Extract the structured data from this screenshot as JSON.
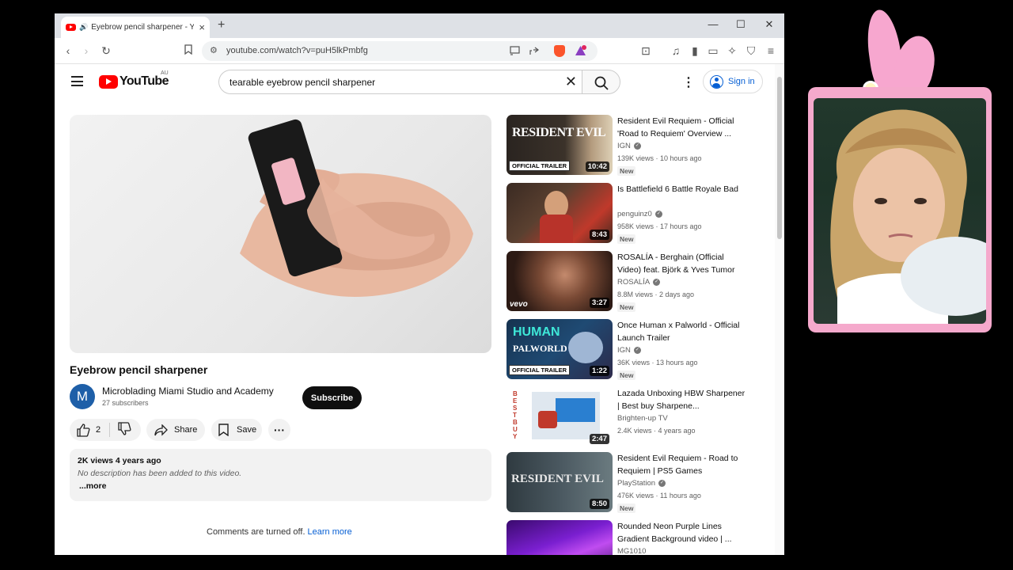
{
  "browser": {
    "tab_title": "Eyebrow pencil sharpener - Y",
    "url": "youtube.com/watch?v=puH5lkPmbfg"
  },
  "youtube": {
    "logo_text": "YouTube",
    "region": "AU",
    "search_query": "tearable eyebrow pencil sharpener",
    "sign_in": "Sign in"
  },
  "video": {
    "title": "Eyebrow pencil sharpener",
    "channel_initial": "M",
    "channel_name": "Microblading Miami Studio and Academy",
    "subscribers": "27 subscribers",
    "subscribe_label": "Subscribe",
    "like_count": "2",
    "share_label": "Share",
    "save_label": "Save",
    "views_age": "2K views  4 years ago",
    "description": "No description has been added to this video.",
    "more_label": "...more",
    "comments_text": "Comments are turned off.",
    "learn_more": "Learn more"
  },
  "recommendations": [
    {
      "title": "Resident Evil Requiem - Official 'Road to Requiem' Overview ...",
      "channel": "IGN",
      "verified": true,
      "views": "139K views · 10 hours ago",
      "badge": "New",
      "duration": "10:42",
      "thumb_label": "OFFICIAL TRAILER",
      "thumb_text": "RESIDENT EVIL"
    },
    {
      "title": "Is Battlefield 6 Battle Royale Bad",
      "channel": "penguinz0",
      "verified": true,
      "views": "958K views · 17 hours ago",
      "badge": "New",
      "duration": "8:43"
    },
    {
      "title": "ROSALÍA - Berghain (Official Video) feat. Björk & Yves Tumor",
      "channel": "ROSALÍA",
      "verified": true,
      "views": "8.8M views · 2 days ago",
      "badge": "New",
      "duration": "3:27",
      "thumb_text": "vevo"
    },
    {
      "title": "Once Human x Palworld - Official Launch Trailer",
      "channel": "IGN",
      "verified": true,
      "views": "36K views · 13 hours ago",
      "badge": "New",
      "duration": "1:22",
      "thumb_label": "OFFICIAL TRAILER",
      "thumb_text": "HUMAN",
      "thumb_text2": "PALWORLD"
    },
    {
      "title": "Lazada Unboxing HBW Sharpener | Best buy Sharpene...",
      "channel": "Brighten-up TV",
      "verified": false,
      "views": "2.4K views · 4 years ago",
      "badge": "",
      "duration": "2:47",
      "thumb_text": "BESTBUY"
    },
    {
      "title": "Resident Evil Requiem - Road to Requiem | PS5 Games",
      "channel": "PlayStation",
      "verified": true,
      "views": "476K views · 11 hours ago",
      "badge": "New",
      "duration": "8:50",
      "thumb_text": "RESIDENT EVIL"
    },
    {
      "title": "Rounded Neon Purple Lines Gradient Background video | ...",
      "channel": "MG1010",
      "verified": false,
      "views": "",
      "badge": "",
      "duration": ""
    }
  ],
  "colors": {
    "yt_red": "#ff0000",
    "link_blue": "#065fd4",
    "webcam_frame": "#f5a9cc"
  },
  "icons": [
    "yt-favicon-icon",
    "speaker-icon",
    "close-icon",
    "plus-icon",
    "back-icon",
    "forward-icon",
    "reload-icon",
    "bookmark-icon",
    "site-info-icon",
    "cast-icon",
    "share-icon",
    "brave-shield-icon",
    "brave-rewards-icon",
    "menu-icon",
    "search-icon",
    "kebab-icon",
    "like-icon",
    "dislike-icon",
    "save-icon"
  ]
}
